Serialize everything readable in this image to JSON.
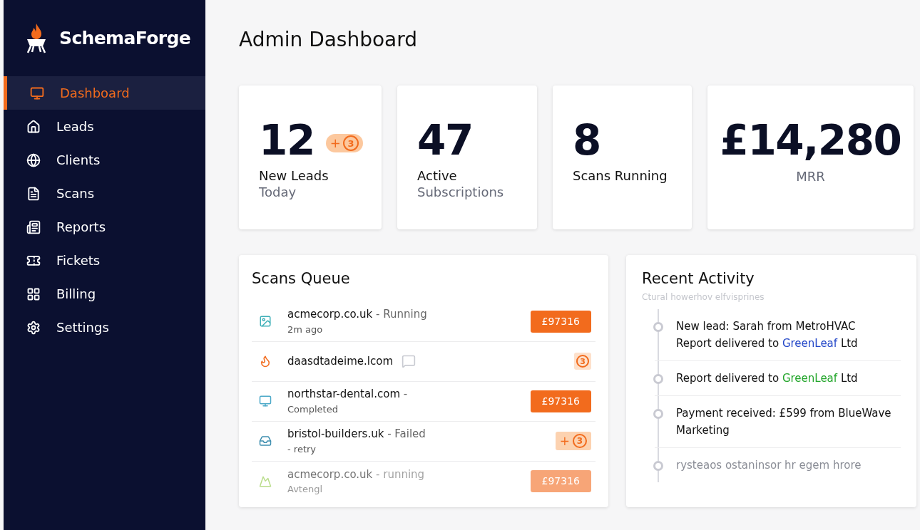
{
  "brand": {
    "name": "SchemaForge"
  },
  "sidebar": {
    "items": [
      {
        "label": "Dashboard",
        "selected": true
      },
      {
        "label": "Leads",
        "selected": false
      },
      {
        "label": "Clients",
        "selected": false
      },
      {
        "label": "Scans",
        "selected": false
      },
      {
        "label": "Reports",
        "selected": false
      },
      {
        "label": "Fickets",
        "selected": false
      },
      {
        "label": "Billing",
        "selected": false
      },
      {
        "label": "Settings",
        "selected": false
      }
    ]
  },
  "page": {
    "title": "Admin Dashboard"
  },
  "stats": [
    {
      "kind": "plain",
      "value": "12",
      "badge": {
        "plus": "+",
        "count": "3"
      },
      "label": "New Leads",
      "sublabel": "Today"
    },
    {
      "kind": "plain",
      "value": "47",
      "label": "Active",
      "sublabel": "Subscriptions"
    },
    {
      "kind": "plain",
      "value": "8",
      "label": "Scans Running"
    },
    {
      "kind": "centered",
      "value": "£14,280",
      "sublabel": "MRR"
    }
  ],
  "scans_queue": {
    "title": "Scans Queue",
    "rows": [
      {
        "domain": "acmecorp.co.uk",
        "status": " - Running",
        "sub": "2m ago",
        "badge": {
          "kind": "price",
          "text": "£97316"
        },
        "faded": false
      },
      {
        "domain": "daasdtadeime.lcom",
        "badge": {
          "kind": "count",
          "count": "3"
        },
        "faded": false
      },
      {
        "domain": "northstar-dental.com",
        "status": " -",
        "sub": "Completed",
        "badge": {
          "kind": "price",
          "text": "£97316"
        },
        "faded": false
      },
      {
        "domain": "bristol-builders.uk",
        "status": " - Failed",
        "sub": "- retry",
        "badge": {
          "kind": "plus_count",
          "plus": "+",
          "count": "3"
        },
        "faded": false
      },
      {
        "domain": "acmecorp.co.uk",
        "status": " - running",
        "sub": "Avtengl",
        "badge": {
          "kind": "price",
          "text": "£97316"
        },
        "faded": true
      }
    ]
  },
  "recent_activity": {
    "title": "Recent Activity",
    "subtitle": "Ctural howerhov elfvisprines",
    "items": [
      {
        "lines": [
          [
            {
              "text": "New lead: Sarah from MetroHVAC"
            }
          ],
          [
            {
              "text": "Report delivered to "
            },
            {
              "text": "GreenLeaf",
              "color": "#2347c8"
            },
            {
              "text": " Ltd"
            }
          ]
        ],
        "faded": false
      },
      {
        "lines": [
          [
            {
              "text": "Report delivered to "
            },
            {
              "text": "GreenLeaf",
              "color": "#22a52a"
            },
            {
              "text": " Ltd"
            }
          ]
        ],
        "faded": false
      },
      {
        "lines": [
          [
            {
              "text": "Payment received: £599 from BlueWave Marketing"
            }
          ]
        ],
        "faded": false
      },
      {
        "lines": [
          [
            {
              "text": "rysteaos ostaninsor hr egem hrore"
            }
          ]
        ],
        "faded": true
      }
    ]
  }
}
